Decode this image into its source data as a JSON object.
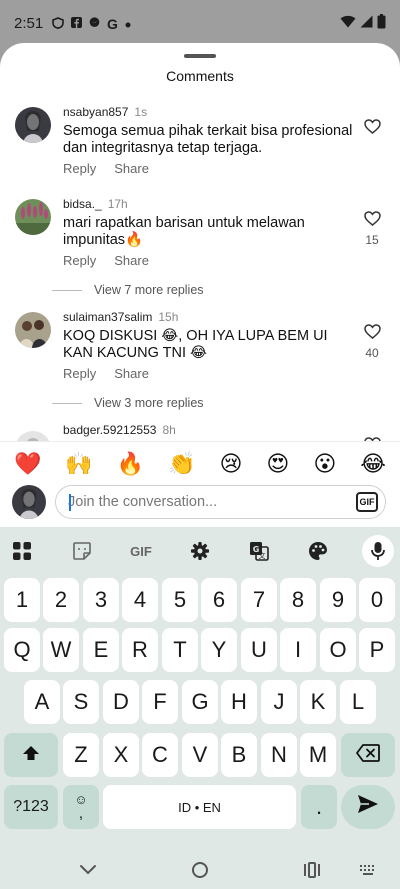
{
  "status_bar": {
    "time": "2:51"
  },
  "sheet": {
    "title": "Comments"
  },
  "comments": [
    {
      "username": "nsabyan857",
      "time": "1s",
      "text": "Semoga semua pihak terkait bisa profesional dan integritasnya tetap terjaga.",
      "reply": "Reply",
      "share": "Share",
      "likes": ""
    },
    {
      "username": "bidsa._",
      "time": "17h",
      "text": "mari rapatkan barisan untuk melawan impunitas🔥",
      "reply": "Reply",
      "share": "Share",
      "likes": "15",
      "view_replies": "View 7 more replies"
    },
    {
      "username": "sulaiman37salim",
      "time": "15h",
      "text": "KOQ DISKUSI 😂, OH IYA LUPA BEM UI KAN KACUNG TNI 😂",
      "reply": "Reply",
      "share": "Share",
      "likes": "40",
      "view_replies": "View 3 more replies"
    },
    {
      "username": "badger.59212553",
      "time": "8h"
    }
  ],
  "emoji_reactions": [
    "❤️",
    "🙌",
    "🔥",
    "👏",
    "😢",
    "😍",
    "😮",
    "😂"
  ],
  "composer": {
    "placeholder": "Join the conversation...",
    "gif_label": "GIF"
  },
  "keyboard": {
    "toolbar": [
      "apps-grid-icon",
      "sticker-icon",
      "GIF",
      "settings-gear-icon",
      "translate-icon",
      "palette-icon",
      "mic-icon"
    ],
    "row_numbers": [
      "1",
      "2",
      "3",
      "4",
      "5",
      "6",
      "7",
      "8",
      "9",
      "0"
    ],
    "row1": [
      "Q",
      "W",
      "E",
      "R",
      "T",
      "Y",
      "U",
      "I",
      "O",
      "P"
    ],
    "row2": [
      "A",
      "S",
      "D",
      "F",
      "G",
      "H",
      "J",
      "K",
      "L"
    ],
    "row3": [
      "Z",
      "X",
      "C",
      "V",
      "B",
      "N",
      "M"
    ],
    "symbols_key": "?123",
    "comma_key": ",",
    "space_label": "ID • EN",
    "period_key": "."
  }
}
